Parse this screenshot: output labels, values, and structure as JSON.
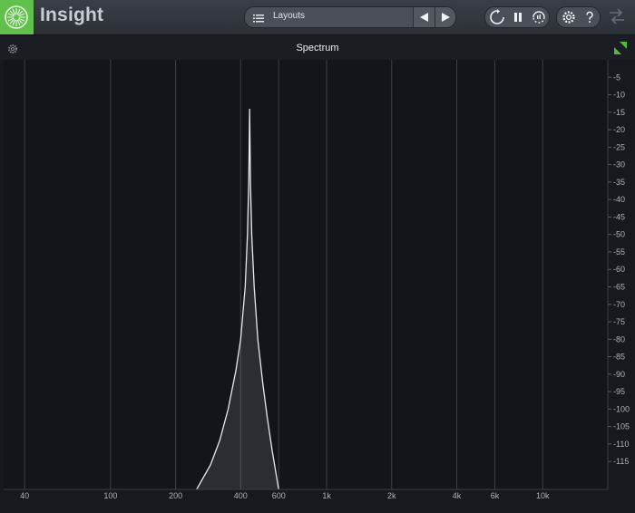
{
  "app": {
    "title": "Insight",
    "logo_icon": "insight-logo-icon",
    "accent": "#61c04b"
  },
  "toolbar": {
    "layouts_label": "Layouts",
    "list_icon": "list-icon",
    "prev_icon": "triangle-left-icon",
    "next_icon": "triangle-right-icon",
    "buttons": [
      "reset-icon",
      "pause-icon",
      "capture-icon",
      "gear-icon",
      "help-icon"
    ]
  },
  "panel": {
    "title": "Spectrum",
    "settings_icon": "gear-icon",
    "corner_icon": "resize-corner-icon"
  },
  "chart_data": {
    "type": "area",
    "title": "Spectrum",
    "xscale": "log",
    "xlim": [
      32,
      20000
    ],
    "ylim": [
      -123,
      0
    ],
    "grid": true,
    "x_ticks": [
      {
        "label": "40",
        "value": 40
      },
      {
        "label": "100",
        "value": 100
      },
      {
        "label": "200",
        "value": 200
      },
      {
        "label": "400",
        "value": 400
      },
      {
        "label": "600",
        "value": 600
      },
      {
        "label": "1k",
        "value": 1000
      },
      {
        "label": "2k",
        "value": 2000
      },
      {
        "label": "4k",
        "value": 4000
      },
      {
        "label": "6k",
        "value": 6000
      },
      {
        "label": "10k",
        "value": 10000
      }
    ],
    "y_ticks": [
      "-5",
      "-10",
      "-15",
      "-20",
      "-25",
      "-30",
      "-35",
      "-40",
      "-45",
      "-50",
      "-55",
      "-60",
      "-65",
      "-70",
      "-75",
      "-80",
      "-85",
      "-90",
      "-95",
      "-100",
      "-105",
      "-110",
      "-115"
    ],
    "series": [
      {
        "color": "#e6e9ee",
        "points": [
          [
            250,
            -123
          ],
          [
            290,
            -116
          ],
          [
            320,
            -109
          ],
          [
            350,
            -100
          ],
          [
            380,
            -89
          ],
          [
            400,
            -80
          ],
          [
            420,
            -65
          ],
          [
            430,
            -50
          ],
          [
            436,
            -35
          ],
          [
            440,
            -14
          ],
          [
            444,
            -35
          ],
          [
            450,
            -50
          ],
          [
            462,
            -65
          ],
          [
            480,
            -80
          ],
          [
            505,
            -92
          ],
          [
            530,
            -102
          ],
          [
            560,
            -112
          ],
          [
            600,
            -123
          ]
        ]
      }
    ]
  }
}
